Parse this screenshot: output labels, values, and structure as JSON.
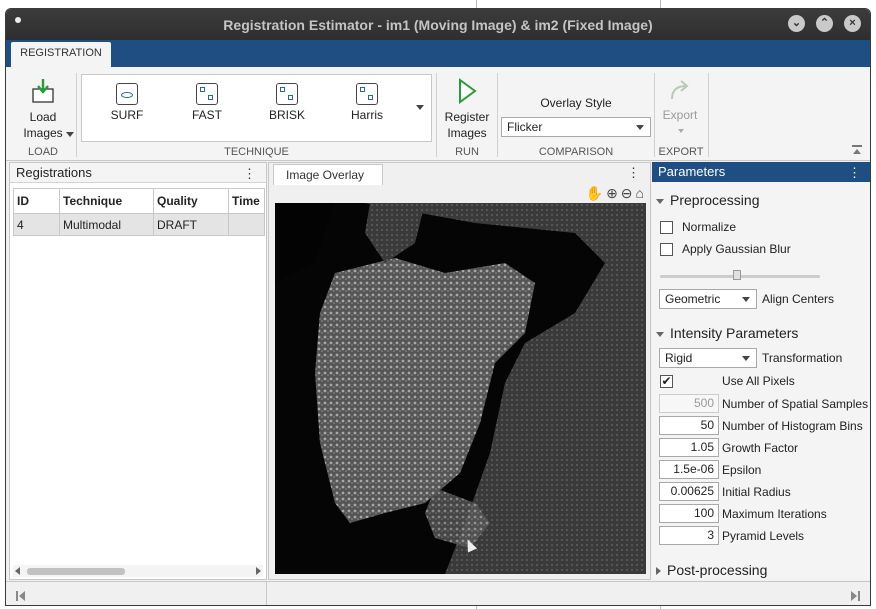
{
  "window": {
    "title": "Registration Estimator - im1 (Moving Image) & im2 (Fixed Image)"
  },
  "toolstrip": {
    "tab_label": "REGISTRATION"
  },
  "load_group": {
    "label": "LOAD",
    "load_button": "Load\nImages"
  },
  "technique_group": {
    "label": "TECHNIQUE",
    "items": [
      "SURF",
      "FAST",
      "BRISK",
      "Harris"
    ]
  },
  "run_group": {
    "label": "RUN",
    "register_button": "Register\nImages"
  },
  "comparison_group": {
    "label": "COMPARISON",
    "overlay_style_label": "Overlay Style",
    "overlay_style_value": "Flicker"
  },
  "export_group": {
    "label": "EXPORT",
    "export_button": "Export"
  },
  "registrations_panel": {
    "title": "Registrations",
    "columns": [
      "ID",
      "Technique",
      "Quality",
      "Time"
    ],
    "rows": [
      {
        "id": "4",
        "technique": "Multimodal",
        "quality": "DRAFT",
        "time": ""
      }
    ]
  },
  "overlay_panel": {
    "tab_label": "Image Overlay"
  },
  "parameters_panel": {
    "title": "Parameters",
    "preprocessing": {
      "label": "Preprocessing",
      "normalize_label": "Normalize",
      "normalize_checked": false,
      "blur_label": "Apply Gaussian Blur",
      "blur_checked": false,
      "align_value": "Geometric",
      "align_label": "Align Centers"
    },
    "intensity": {
      "label": "Intensity Parameters",
      "transformation_value": "Rigid",
      "transformation_label": "Transformation",
      "use_all_pixels_label": "Use All Pixels",
      "use_all_pixels_checked": true,
      "spatial_samples_value": "500",
      "spatial_samples_label": "Number of Spatial Samples",
      "histogram_bins_value": "50",
      "histogram_bins_label": "Number of Histogram Bins",
      "growth_factor_value": "1.05",
      "growth_factor_label": "Growth Factor",
      "epsilon_value": "1.5e-06",
      "epsilon_label": "Epsilon",
      "initial_radius_value": "0.00625",
      "initial_radius_label": "Initial Radius",
      "max_iterations_value": "100",
      "max_iterations_label": "Maximum Iterations",
      "pyramid_levels_value": "3",
      "pyramid_levels_label": "Pyramid Levels"
    },
    "postprocessing": {
      "label": "Post-processing"
    }
  },
  "colors": {
    "accent": "#1f4e82",
    "titlebar": "#333333"
  }
}
